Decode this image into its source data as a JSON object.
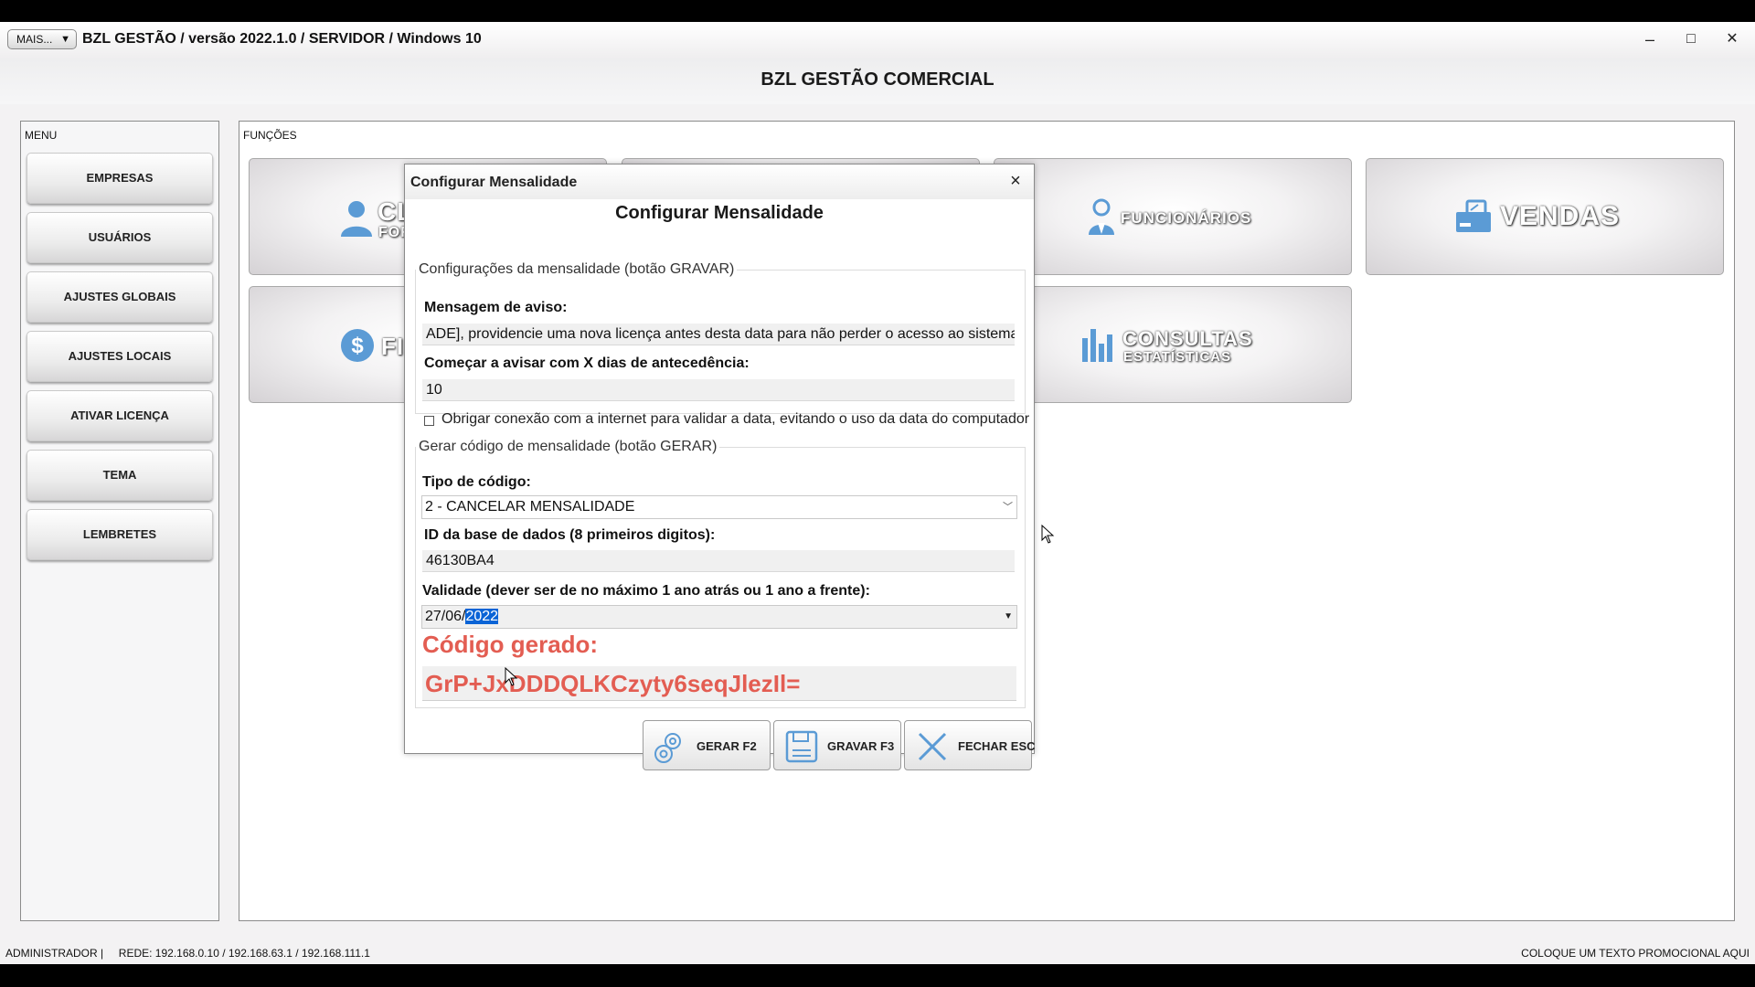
{
  "window": {
    "mais_label": "MAIS...",
    "title": "BZL GESTÃO / versão 2022.1.0 / SERVIDOR / Windows 10",
    "minimize": "–",
    "maximize": "□",
    "close": "✕"
  },
  "app": {
    "title": "BZL GESTÃO COMERCIAL"
  },
  "menu": {
    "label": "MENU",
    "items": [
      {
        "label": "EMPRESAS"
      },
      {
        "label": "USUÁRIOS"
      },
      {
        "label": "AJUSTES GLOBAIS"
      },
      {
        "label": "AJUSTES LOCAIS"
      },
      {
        "label": "ATIVAR LICENÇA"
      },
      {
        "label": "TEMA"
      },
      {
        "label": "LEMBRETES"
      }
    ]
  },
  "functions": {
    "label": "FUNÇÕES",
    "tiles": {
      "clientes": {
        "title": "CL",
        "sub": "FOR",
        "icon": "person-icon"
      },
      "financeiro": {
        "title": "FI",
        "icon": "dollar-icon"
      },
      "funcionarios": {
        "title": "FUNCIONÁRIOS",
        "icon": "employee-icon"
      },
      "vendas": {
        "title": "VENDAS",
        "icon": "cash-register-icon"
      },
      "consultas": {
        "title": "CONSULTAS",
        "sub": "ESTATÍSTICAS",
        "icon": "bar-chart-icon"
      }
    }
  },
  "dialog": {
    "title": "Configurar Mensalidade",
    "heading": "Configurar Mensalidade",
    "close": "×",
    "config_group": {
      "legend": "Configurações da mensalidade (botão GRAVAR)",
      "message_label": "Mensagem de aviso:",
      "message_value": "ADE], providencie uma nova licença antes desta data para não perder o acesso ao sistema!",
      "days_label": "Começar a avisar com X dias de antecedência:",
      "days_value": "10",
      "internet_check_label": "Obrigar conexão com a internet para validar a data, evitando o uso da data do computador",
      "internet_checked": false
    },
    "generate_group": {
      "legend": "Gerar código de mensalidade (botão GERAR)",
      "type_label": "Tipo de código:",
      "type_value": "2 - CANCELAR MENSALIDADE",
      "db_id_label": "ID da base de dados (8 primeiros digitos):",
      "db_id_value": "46130BA4",
      "validity_label": "Validade (dever ser de no máximo 1 ano atrás ou 1 ano a frente):",
      "validity_date_prefix": "27/06/",
      "validity_date_selected": "2022",
      "code_label": "Código gerado:",
      "code_value": "GrP+JxDDDQLKCzyty6seqJlezIl="
    },
    "buttons": {
      "gerar": "GERAR F2",
      "gravar": "GRAVAR F3",
      "fechar": "FECHAR ESC"
    }
  },
  "status": {
    "left": "ADMINISTRADOR |     REDE: 192.168.0.10 / 192.168.63.1 / 192.168.111.1",
    "right": "COLOQUE UM TEXTO PROMOCIONAL AQUI"
  },
  "colors": {
    "accent_blue": "#5b9bd5",
    "code_red": "#e35d52",
    "selection_blue": "#0a64d6"
  }
}
